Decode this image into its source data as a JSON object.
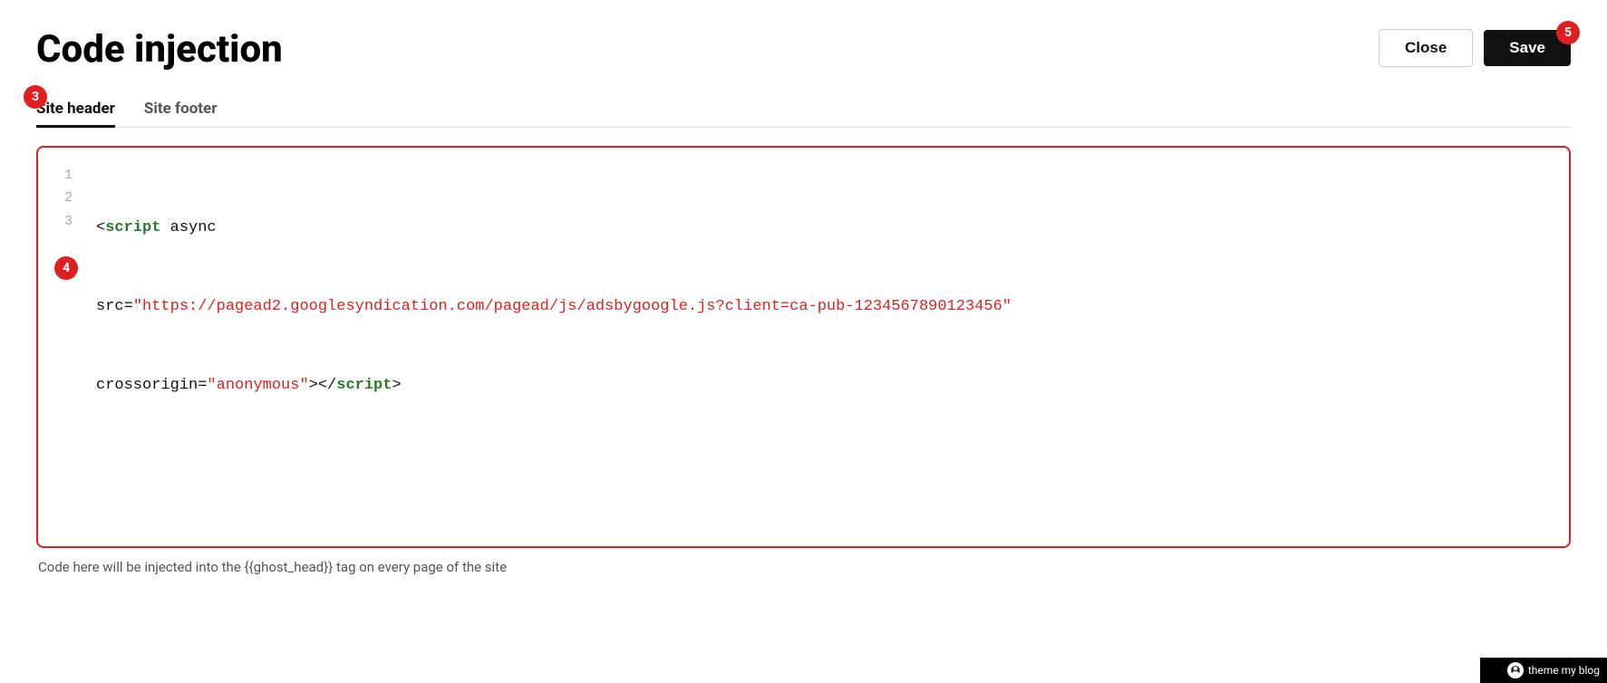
{
  "page": {
    "title": "Code injection"
  },
  "header": {
    "close_label": "Close",
    "save_label": "Save"
  },
  "tabs": [
    {
      "id": "site-header",
      "label": "Site header",
      "active": true,
      "badge": "3"
    },
    {
      "id": "site-footer",
      "label": "Site footer",
      "active": false
    }
  ],
  "editor": {
    "badge": "4",
    "lines": [
      {
        "num": 1,
        "parts": [
          {
            "type": "bracket",
            "text": "<"
          },
          {
            "type": "tag",
            "text": "script"
          },
          {
            "type": "plain",
            "text": " async"
          }
        ]
      },
      {
        "num": 2,
        "parts": [
          {
            "type": "plain",
            "text": "src="
          },
          {
            "type": "attr-value",
            "text": "\"https://pagead2.googlesyndication.com/pagead/js/adsbygoogle.js?client=ca-pub-1234567890123456\""
          }
        ]
      },
      {
        "num": 3,
        "parts": [
          {
            "type": "plain",
            "text": "crossorigin="
          },
          {
            "type": "attr-value",
            "text": "\"anonymous\""
          },
          {
            "type": "bracket",
            "text": "></"
          },
          {
            "type": "tag",
            "text": "script"
          },
          {
            "type": "bracket",
            "text": ">"
          }
        ]
      }
    ]
  },
  "footer": {
    "note": "Code here will be injected into the {{ghost_head}} tag on every page of the site"
  },
  "branding": {
    "label": "theme my blog"
  },
  "badges": {
    "tab": "3",
    "editor": "4",
    "save": "5"
  }
}
